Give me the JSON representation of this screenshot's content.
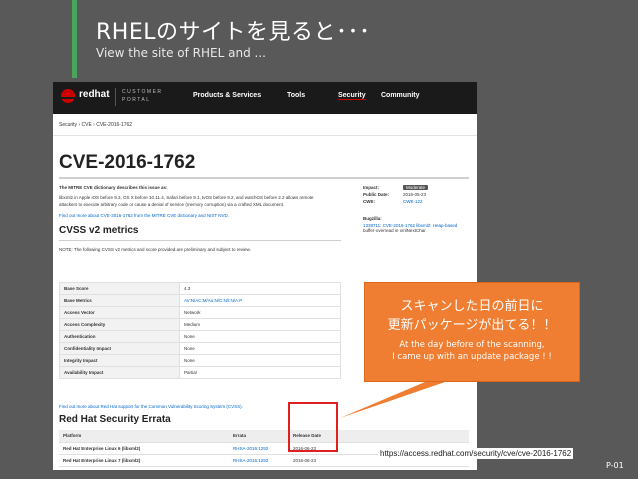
{
  "slide": {
    "title": "RHELのサイトを見ると･･･",
    "subtitle": "View the site of RHEL and ...",
    "callout_jp_line1": "スキャンした日の前日に",
    "callout_jp_line2": "更新パッケージが出てる！！",
    "callout_en_line1": "At the day before of the scanning,",
    "callout_en_line2": "I came up with an update package ! !",
    "url": "https://access.redhat.com/security/cve/cve-2016-1762",
    "page_number": "P-01",
    "accent_color": "#4aa45c",
    "callout_color": "#ef7d32"
  },
  "site": {
    "logo": "redhat",
    "portal_line1": "CUSTOMER",
    "portal_line2": "PORTAL",
    "nav": [
      "Products & Services",
      "Tools",
      "Security",
      "Community"
    ],
    "breadcrumb": "Security  ›  CVE  ›  CVE-2016-1762",
    "page_title": "CVE-2016-1762",
    "description_heading": "The MITRE CVE dictionary describes this issue as:",
    "description_line1": "libxml2 in Apple iOS before 9.3, OS X before 10.11.4, Safari before 9.1, tvOS before 9.2, and watchOS before 2.2 allows remote",
    "description_line2": "attackers to execute arbitrary code or cause a denial of service (memory corruption) via a crafted XML document.",
    "find_more": "Find out more about CVE-2016-1762 from the MITRE CVE dictionary and NIST NVD.",
    "impact_label": "Impact:",
    "impact_value": "Moderate",
    "public_date_label": "Public Date:",
    "public_date_value": "2016-05-23",
    "cwe_label": "CWE:",
    "cwe_value": "CWE-122",
    "bugzilla_label": "Bugzilla:",
    "bugzilla_line1": "1338711: CVE-2016-1762 libxml2: Heap-based",
    "bugzilla_line2": "buffer-overread in xmlNextChar",
    "cvss_heading": "CVSS v2 metrics",
    "cvss_note": "NOTE: The following CVSS v2 metrics and score provided are preliminary and subject to review.",
    "cvss_rows": [
      {
        "k": "Base Score",
        "v": "4.3"
      },
      {
        "k": "Base Metrics",
        "v": "AV:N/AC:M/Au:N/C:N/I:N/A:P"
      },
      {
        "k": "Access Vector",
        "v": "Network"
      },
      {
        "k": "Access Complexity",
        "v": "Medium"
      },
      {
        "k": "Authentication",
        "v": "None"
      },
      {
        "k": "Confidentiality Impact",
        "v": "None"
      },
      {
        "k": "Integrity Impact",
        "v": "None"
      },
      {
        "k": "Availability Impact",
        "v": "Partial"
      }
    ],
    "cvss_more": "Find out more about Red Hat support for the Common Vulnerability Scoring System (CVSS).",
    "errata_heading": "Red Hat Security Errata",
    "errata_columns": [
      "Platform",
      "Errata",
      "Release Date"
    ],
    "errata_rows": [
      {
        "platform": "Red Hat Enterprise Linux 6 (libxml2)",
        "errata": "RHSA-2016:1292",
        "date": "2016-06-23"
      },
      {
        "platform": "Red Hat Enterprise Linux 7 (libxml2)",
        "errata": "RHSA-2016:1292",
        "date": "2016-06-23"
      }
    ]
  }
}
